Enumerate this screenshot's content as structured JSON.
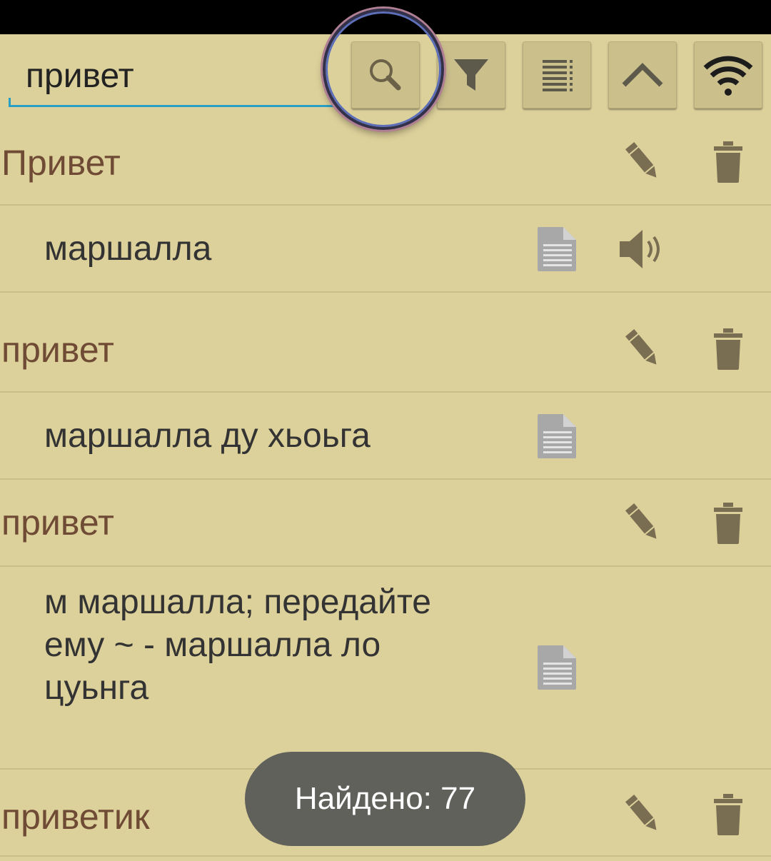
{
  "search": {
    "value": "привет"
  },
  "toolbar": {
    "buttons": [
      {
        "name": "search-button",
        "icon": "search-icon"
      },
      {
        "name": "filter-button",
        "icon": "filter-icon"
      },
      {
        "name": "list-button",
        "icon": "list-icon"
      },
      {
        "name": "collapse-button",
        "icon": "chevron-up-icon"
      },
      {
        "name": "wifi-button",
        "icon": "wifi-icon"
      }
    ]
  },
  "entries": [
    {
      "word": "Привет",
      "translation": "маршалла",
      "has_sound": true
    },
    {
      "word": "привет",
      "translation": "маршалла ду хьоьга",
      "has_sound": false
    },
    {
      "word": "привет",
      "translation": "м маршалла; передайте\nему ~ - маршалла ло\nцуьнга",
      "has_sound": false
    },
    {
      "word": "приветик"
    }
  ],
  "toast": {
    "text": "Найдено: 77"
  },
  "colors": {
    "background": "#ddd19b",
    "word": "#6f4a34",
    "icon": "#7a6e52",
    "accent": "#2a9fc6",
    "toast": "#61615c"
  }
}
